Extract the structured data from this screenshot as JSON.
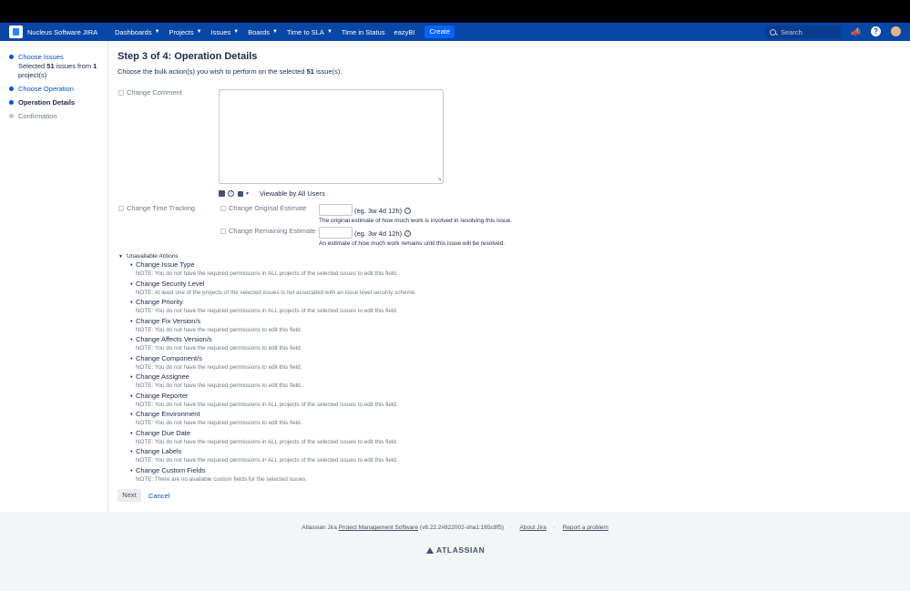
{
  "nav": {
    "app_title": "Nucleus Software JIRA",
    "items": [
      {
        "label": "Dashboards",
        "dropdown": true
      },
      {
        "label": "Projects",
        "dropdown": true
      },
      {
        "label": "Issues",
        "dropdown": true
      },
      {
        "label": "Boards",
        "dropdown": true
      },
      {
        "label": "Time to SLA",
        "dropdown": true
      },
      {
        "label": "Time in Status",
        "dropdown": false
      },
      {
        "label": "eazyBI",
        "dropdown": false
      }
    ],
    "create_label": "Create",
    "search_placeholder": "Search",
    "accent_color": "#0747a6"
  },
  "sidebar": {
    "steps": [
      {
        "label": "Choose Issues",
        "state": "link"
      },
      {
        "label": "Choose Operation",
        "state": "link"
      },
      {
        "label": "Operation Details",
        "state": "current"
      },
      {
        "label": "Confirmation",
        "state": "pending"
      }
    ],
    "selected_prefix": "Selected",
    "selected_count": "51",
    "selected_mid": "issues from",
    "project_count": "1",
    "selected_suffix": "project(s)"
  },
  "main": {
    "title": "Step 3 of 4: Operation Details",
    "intro_prefix": "Choose the bulk action(s) you wish to perform on the selected",
    "intro_count": "51",
    "intro_suffix": "issue(s).",
    "change_comment_label": "Change Comment",
    "comment_visibility": "Viewable by All Users",
    "change_time_tracking_label": "Change Time Tracking",
    "original_estimate_label": "Change Original Estimate",
    "original_estimate_hint": "(eg. 3w 4d 12h)",
    "original_estimate_desc": "The original estimate of how much work is involved in resolving this issue.",
    "remaining_estimate_label": "Change Remaining Estimate",
    "remaining_estimate_hint": "(eg. 3w 4d 12h)",
    "remaining_estimate_desc": "An estimate of how much work remains until this issue will be resolved.",
    "unavailable_heading": "Unavailable Actions",
    "unavailable": [
      {
        "title": "Change Issue Type",
        "note": "NOTE: You do not have the required permissions in ALL projects of the selected issues to edit this field."
      },
      {
        "title": "Change Security Level",
        "note": "NOTE: At least one of the projects of the selected issues is not associated with an issue level security scheme."
      },
      {
        "title": "Change Priority",
        "note": "NOTE: You do not have the required permissions in ALL projects of the selected issues to edit this field."
      },
      {
        "title": "Change Fix Version/s",
        "note": "NOTE: You do not have the required permissions to edit this field."
      },
      {
        "title": "Change Affects Version/s",
        "note": "NOTE: You do not have the required permissions to edit this field."
      },
      {
        "title": "Change Component/s",
        "note": "NOTE: You do not have the required permissions to edit this field."
      },
      {
        "title": "Change Assignee",
        "note": "NOTE: You do not have the required permissions to edit this field."
      },
      {
        "title": "Change Reporter",
        "note": "NOTE: You do not have the required permissions in ALL projects of the selected issues to edit this field."
      },
      {
        "title": "Change Environment",
        "note": "NOTE: You do not have the required permissions to edit this field."
      },
      {
        "title": "Change Due Date",
        "note": "NOTE: You do not have the required permissions in ALL projects of the selected issues to edit this field."
      },
      {
        "title": "Change Labels",
        "note": "NOTE: You do not have the required permissions in ALL projects of the selected issues to edit this field."
      },
      {
        "title": "Change Custom Fields",
        "note": "NOTE: There are no available custom fields for the selected issues."
      }
    ],
    "next_label": "Next",
    "cancel_label": "Cancel"
  },
  "footer": {
    "prefix": "Atlassian Jira",
    "pms_link": "Project Management Software",
    "version": "(v8.22.2#822002-sha1:165c8f5)",
    "about": "About Jira",
    "report": "Report a problem",
    "brand": "ATLASSIAN"
  }
}
